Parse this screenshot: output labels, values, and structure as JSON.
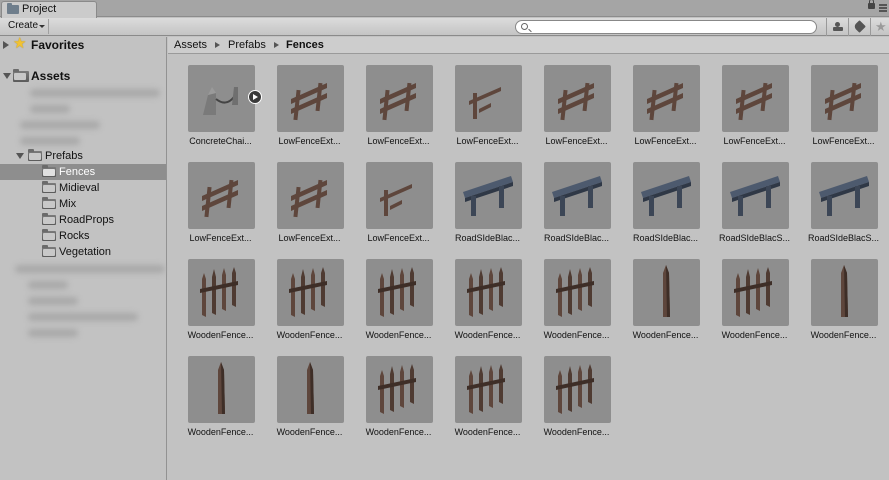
{
  "tab": {
    "title": "Project"
  },
  "toolbar": {
    "create_label": "Create",
    "search_placeholder": ""
  },
  "tree": {
    "favorites": "Favorites",
    "assets": "Assets",
    "prefabs": "Prefabs",
    "children": [
      "Fences",
      "Midieval",
      "Mix",
      "RoadProps",
      "Rocks",
      "Vegetation"
    ],
    "selected": "Fences"
  },
  "breadcrumb": [
    "Assets",
    "Prefabs",
    "Fences"
  ],
  "assets": [
    {
      "name": "ConcreteChai...",
      "icon": "concrete-chain-icon"
    },
    {
      "name": "LowFenceExt...",
      "icon": "low-fence-icon"
    },
    {
      "name": "LowFenceExt...",
      "icon": "low-fence-icon"
    },
    {
      "name": "LowFenceExt...",
      "icon": "low-fence-broken-icon"
    },
    {
      "name": "LowFenceExt...",
      "icon": "low-fence-icon"
    },
    {
      "name": "LowFenceExt...",
      "icon": "low-fence-icon"
    },
    {
      "name": "LowFenceExt...",
      "icon": "low-fence-icon"
    },
    {
      "name": "LowFenceExt...",
      "icon": "low-fence-icon"
    },
    {
      "name": "LowFenceExt...",
      "icon": "low-fence-icon"
    },
    {
      "name": "LowFenceExt...",
      "icon": "low-fence-icon"
    },
    {
      "name": "LowFenceExt...",
      "icon": "low-fence-broken-icon"
    },
    {
      "name": "RoadSIdeBlac...",
      "icon": "guardrail-icon"
    },
    {
      "name": "RoadSIdeBlac...",
      "icon": "guardrail-icon"
    },
    {
      "name": "RoadSIdeBlac...",
      "icon": "guardrail-icon"
    },
    {
      "name": "RoadSIdeBlacS...",
      "icon": "guardrail-icon"
    },
    {
      "name": "RoadSIdeBlacS...",
      "icon": "guardrail-icon"
    },
    {
      "name": "WoodenFence...",
      "icon": "wooden-fence-icon"
    },
    {
      "name": "WoodenFence...",
      "icon": "wooden-fence-icon"
    },
    {
      "name": "WoodenFence...",
      "icon": "wooden-fence-icon"
    },
    {
      "name": "WoodenFence...",
      "icon": "wooden-fence-icon"
    },
    {
      "name": "WoodenFence...",
      "icon": "wooden-fence-icon"
    },
    {
      "name": "WoodenFence...",
      "icon": "wooden-post-icon"
    },
    {
      "name": "WoodenFence...",
      "icon": "wooden-fence-icon"
    },
    {
      "name": "WoodenFence...",
      "icon": "wooden-post-icon"
    },
    {
      "name": "WoodenFence...",
      "icon": "wooden-post-icon"
    },
    {
      "name": "WoodenFence...",
      "icon": "wooden-post-icon"
    },
    {
      "name": "WoodenFence...",
      "icon": "wooden-fence-icon"
    },
    {
      "name": "WoodenFence...",
      "icon": "wooden-fence-icon"
    },
    {
      "name": "WoodenFence...",
      "icon": "wooden-fence-icon"
    }
  ],
  "colors": {
    "selection": "#8e8e8e",
    "thumb_bg": "#8e8e8e",
    "wood": "#5e463c",
    "metal": "#4d5a6e"
  }
}
